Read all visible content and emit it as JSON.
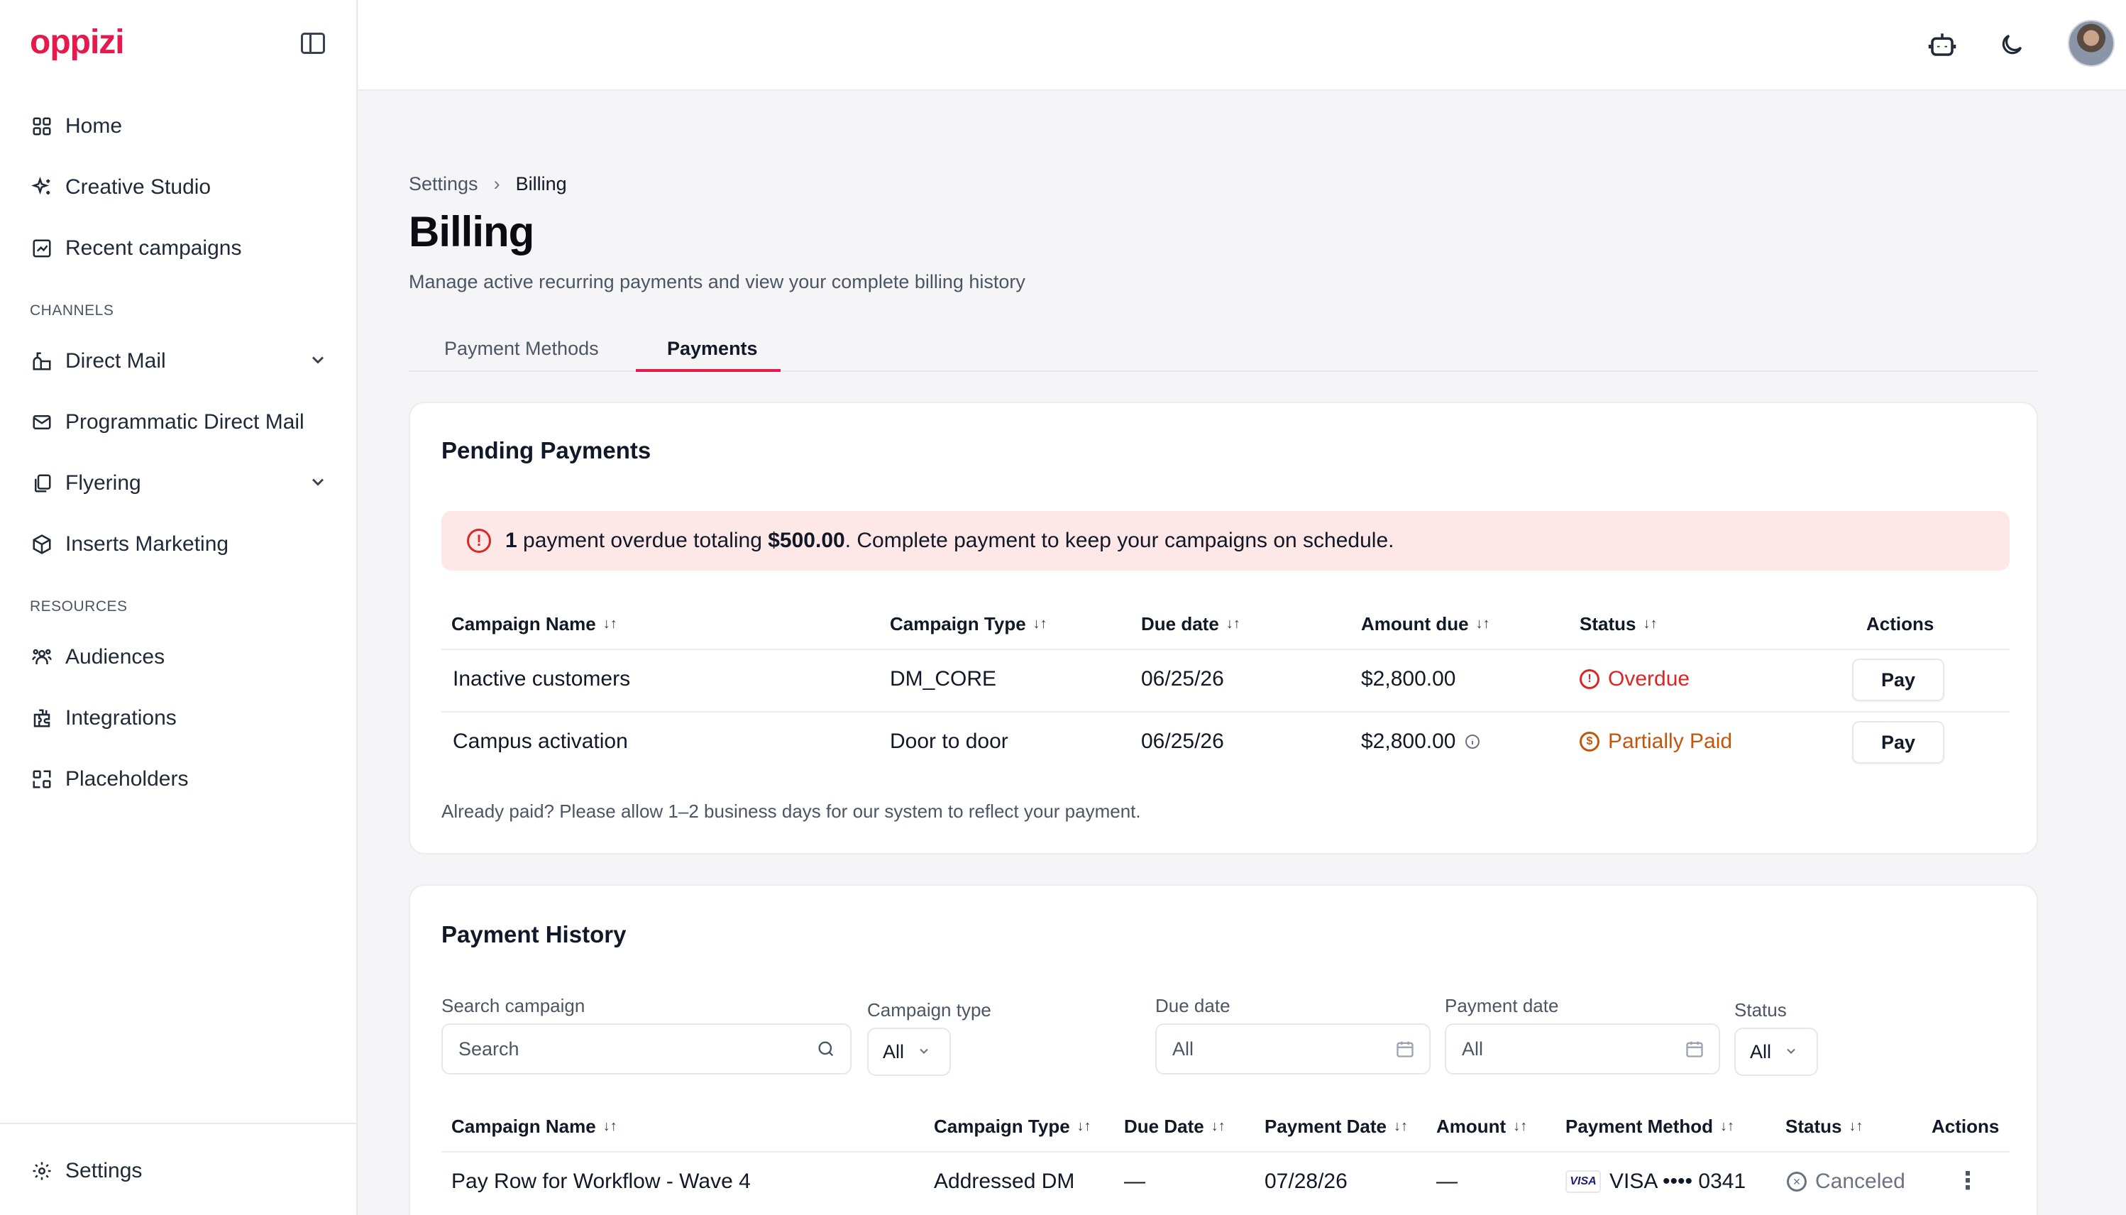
{
  "brand": {
    "logo": "oppizi"
  },
  "sidebar": {
    "items": [
      {
        "label": "Home",
        "icon": "grid-icon"
      },
      {
        "label": "Creative Studio",
        "icon": "sparkles-icon"
      },
      {
        "label": "Recent campaigns",
        "icon": "chart-icon"
      }
    ],
    "channels_label": "CHANNELS",
    "channels": [
      {
        "label": "Direct Mail",
        "icon": "mailbox-icon"
      },
      {
        "label": "Programmatic Direct Mail",
        "icon": "mail-icon"
      },
      {
        "label": "Flyering",
        "icon": "copy-icon"
      },
      {
        "label": "Inserts Marketing",
        "icon": "box-icon"
      }
    ],
    "resources_label": "RESOURCES",
    "resources": [
      {
        "label": "Audiences",
        "icon": "users-icon"
      },
      {
        "label": "Integrations",
        "icon": "puzzle-icon"
      },
      {
        "label": "Placeholders",
        "icon": "placeholder-icon"
      }
    ],
    "footer": {
      "label": "Settings",
      "icon": "gear-icon"
    }
  },
  "breadcrumb": {
    "parent": "Settings",
    "separator": "›",
    "current": "Billing"
  },
  "page": {
    "title": "Billing",
    "subtitle": "Manage active recurring payments and view your complete billing history"
  },
  "tabs": [
    "Payment Methods",
    "Payments"
  ],
  "pending": {
    "title": "Pending Payments",
    "alert": {
      "count": "1",
      "middle": " payment overdue totaling ",
      "amount": "$500.00",
      "tail": ". Complete payment to keep your campaigns on schedule."
    },
    "columns": [
      "Campaign Name",
      "Campaign Type",
      "Due date",
      "Amount due",
      "Status",
      "Actions"
    ],
    "sort_glyph": "↓↑",
    "rows": [
      {
        "name": "Inactive customers",
        "type": "DM_CORE",
        "due": "06/25/26",
        "amount": "$2,800.00",
        "status": "Overdue",
        "action": "Pay"
      },
      {
        "name": "Campus activation",
        "type": "Door to door",
        "due": "06/25/26",
        "amount": "$2,800.00",
        "status": "Partially Paid",
        "action": "Pay"
      }
    ],
    "note": "Already paid? Please allow 1–2 business days for our system to reflect your payment."
  },
  "history": {
    "title": "Payment History",
    "filters": {
      "search_label": "Search campaign",
      "search_placeholder": "Search",
      "type_label": "Campaign type",
      "type_value": "All",
      "due_label": "Due date",
      "due_value": "All",
      "paydate_label": "Payment date",
      "paydate_value": "All",
      "status_label": "Status",
      "status_value": "All"
    },
    "columns": [
      "Campaign Name",
      "Campaign Type",
      "Due Date",
      "Payment Date",
      "Amount",
      "Payment Method",
      "Status",
      "Actions"
    ],
    "rows": [
      {
        "name": "Pay Row for Workflow - Wave 4",
        "type": "Addressed DM",
        "due": "—",
        "paydate": "07/28/26",
        "amount": "—",
        "card_brand": "VISA",
        "method": "VISA •••• 0341",
        "status": "Canceled"
      }
    ]
  },
  "colors": {
    "accent": "#e5194b",
    "danger": "#dc2626",
    "warning": "#c2570c",
    "muted": "#6b7280"
  }
}
